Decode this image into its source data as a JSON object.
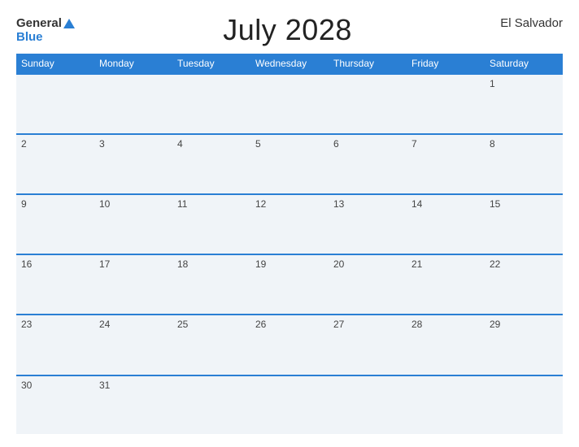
{
  "header": {
    "logo_general": "General",
    "logo_blue": "Blue",
    "title": "July 2028",
    "country": "El Salvador"
  },
  "calendar": {
    "days_of_week": [
      "Sunday",
      "Monday",
      "Tuesday",
      "Wednesday",
      "Thursday",
      "Friday",
      "Saturday"
    ],
    "weeks": [
      [
        "",
        "",
        "",
        "",
        "",
        "",
        "1"
      ],
      [
        "2",
        "3",
        "4",
        "5",
        "6",
        "7",
        "8"
      ],
      [
        "9",
        "10",
        "11",
        "12",
        "13",
        "14",
        "15"
      ],
      [
        "16",
        "17",
        "18",
        "19",
        "20",
        "21",
        "22"
      ],
      [
        "23",
        "24",
        "25",
        "26",
        "27",
        "28",
        "29"
      ],
      [
        "30",
        "31",
        "",
        "",
        "",
        "",
        ""
      ]
    ]
  }
}
